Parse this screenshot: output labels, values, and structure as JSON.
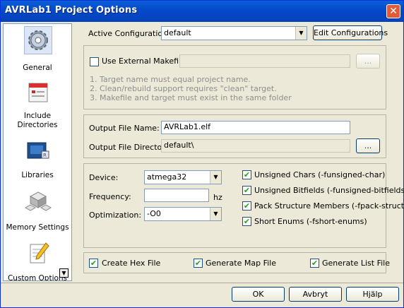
{
  "window": {
    "title": "AVRLab1 Project Options",
    "close_glyph": "✕"
  },
  "sidebar": {
    "items": [
      {
        "label": "General",
        "icon": "gear-icon"
      },
      {
        "label": "Include Directories",
        "icon": "calendar-icon"
      },
      {
        "label": "Libraries",
        "icon": "books-icon"
      },
      {
        "label": "Memory Settings",
        "icon": "blocks-icon"
      },
      {
        "label": "Custom Options",
        "icon": "notepad-pencil-icon"
      }
    ]
  },
  "config": {
    "active_label": "Active Configuration",
    "active_value": "default",
    "edit_button": "Edit Configurations"
  },
  "makefile": {
    "checkbox_label": "Use External Makefile",
    "path_value": "",
    "browse_button": "...",
    "hints": [
      "1. Target name must equal project name.",
      "2. Clean/rebuild support requires \"clean\" target.",
      "3. Makefile and target must exist in the same folder"
    ]
  },
  "output": {
    "file_name_label": "Output File Name:",
    "file_name_value": "AVRLab1.elf",
    "directory_label": "Output File Directory:",
    "directory_value": "default\\",
    "browse_button": "..."
  },
  "device": {
    "device_label": "Device:",
    "device_value": "atmega32",
    "frequency_label": "Frequency:",
    "frequency_value": "",
    "frequency_unit": "hz",
    "optimization_label": "Optimization:",
    "optimization_value": "-O0"
  },
  "compiler_flags": [
    {
      "label": "Unsigned Chars (-funsigned-char)",
      "checked": true
    },
    {
      "label": "Unsigned Bitfields (-funsigned-bitfields)",
      "checked": true
    },
    {
      "label": "Pack Structure Members (-fpack-struct)",
      "checked": true
    },
    {
      "label": "Short Enums (-fshort-enums)",
      "checked": true
    }
  ],
  "generate": {
    "hex": "Create Hex File",
    "map": "Generate Map File",
    "list": "Generate List File"
  },
  "footer": {
    "ok": "OK",
    "cancel": "Avbryt",
    "help": "Hjälp"
  },
  "check_glyph": "✔"
}
